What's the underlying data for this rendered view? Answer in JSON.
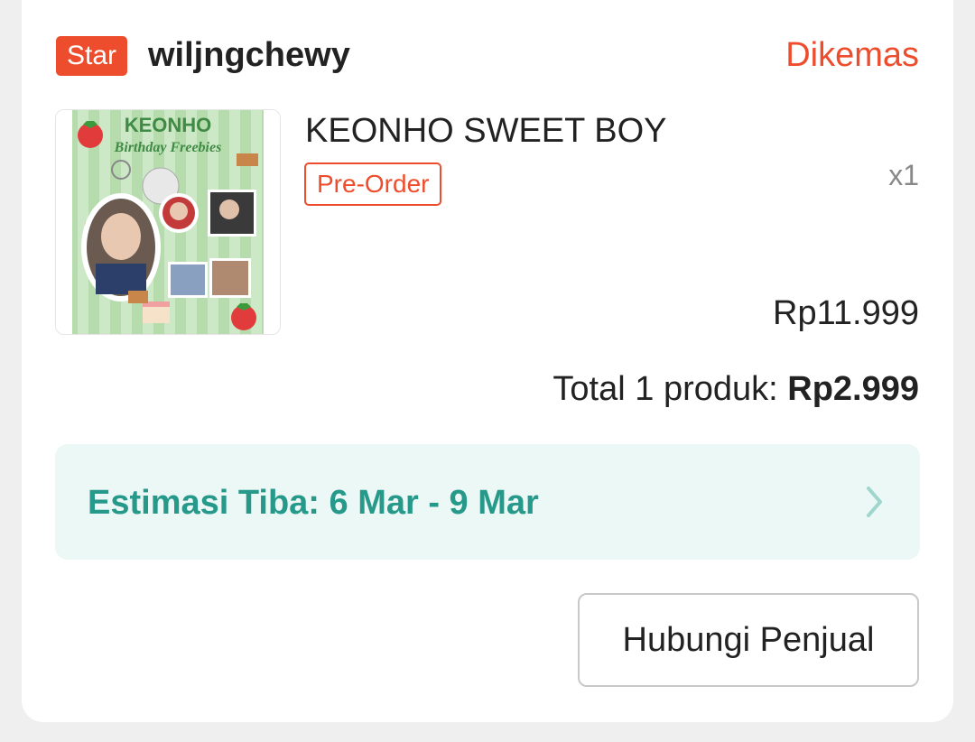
{
  "order": {
    "shop_badge": "Star",
    "shop_name": "wiljngchewy",
    "status": "Dikemas"
  },
  "product": {
    "name": "KEONHO SWEET BOY",
    "tag": "Pre-Order",
    "quantity": "x1",
    "price": "Rp11.999",
    "image": {
      "title": "KEONHO",
      "subtitle": "Birthday Freebies"
    }
  },
  "summary": {
    "total_label": "Total 1 produk: ",
    "total_amount": "Rp2.999"
  },
  "delivery": {
    "estimate": "Estimasi Tiba: 6 Mar - 9 Mar",
    "icon": "chevron-right-icon"
  },
  "actions": {
    "contact_label": "Hubungi Penjual"
  },
  "colors": {
    "accent": "#ee4d2d",
    "eta_text": "#26998a",
    "eta_bg": "#ebf8f5"
  }
}
